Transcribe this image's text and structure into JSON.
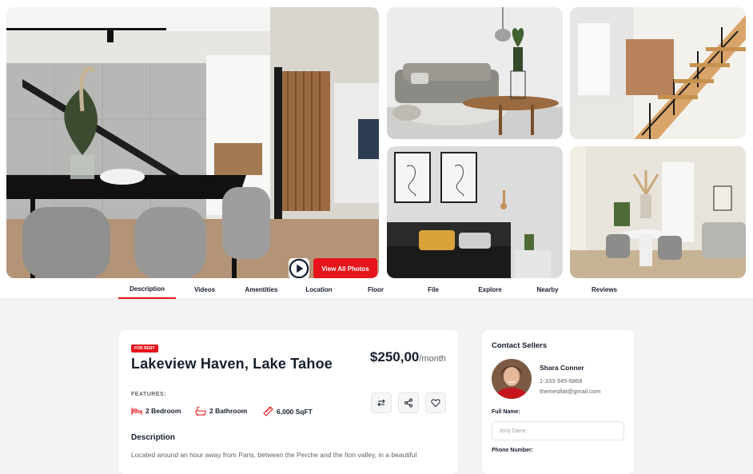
{
  "gallery": {
    "view_all_label": "View All Photos",
    "play_icon": "play-circle-icon",
    "accent": "#e7141b"
  },
  "tabs": [
    {
      "label": "Description",
      "active": true
    },
    {
      "label": "Videos"
    },
    {
      "label": "Amentities"
    },
    {
      "label": "Location"
    },
    {
      "label": "Floor"
    },
    {
      "label": "File"
    },
    {
      "label": "Explore"
    },
    {
      "label": "Nearby"
    },
    {
      "label": "Reviews"
    }
  ],
  "property": {
    "badge": "FOR RENT",
    "title": "Lakeview Haven, Lake Tahoe",
    "price": "$250,00",
    "price_unit": "/month",
    "features_label": "FEATURES:",
    "features": [
      {
        "icon": "bed-icon",
        "label": "2 Bedroom"
      },
      {
        "icon": "bathtub-icon",
        "label": "2 Bathroom"
      },
      {
        "icon": "ruler-icon",
        "label": "6,000 SqFT"
      }
    ],
    "actions": [
      "compare-icon",
      "share-icon",
      "heart-icon"
    ],
    "description_heading": "Description",
    "description_text": "Located around an hour away from Paris, between the Perche and the Iton valley, in a beautiful"
  },
  "contact": {
    "heading": "Contact Sellers",
    "name": "Shara Conner",
    "phone": "1-333-345-6868",
    "email": "themesflat@gmail.com",
    "full_name_label": "Full Name:",
    "full_name_placeholder": "Jony Dane",
    "phone_label": "Phone Number:"
  }
}
